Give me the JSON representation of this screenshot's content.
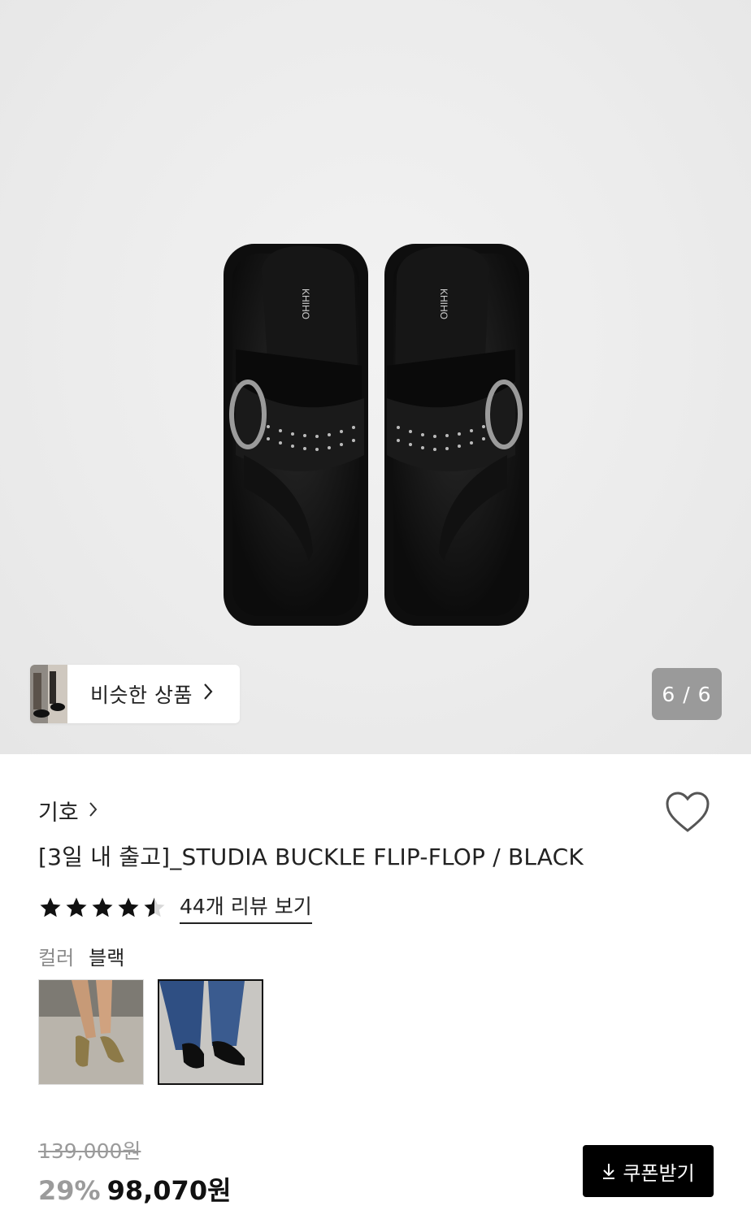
{
  "gallery": {
    "counter": "6 / 6",
    "similar_label": "비슷한 상품",
    "insole_logo": "KHIHO"
  },
  "product": {
    "brand": "기호",
    "title": "[3일 내 출고]_STUDIA BUCKLE FLIP-FLOP / BLACK",
    "rating_stars": 4.5,
    "review_link": "44개 리뷰 보기",
    "color_label": "컬러",
    "color_value": "블랙",
    "original_price": "139,000원",
    "discount": "29%",
    "price": "98,070원",
    "coupon_button": "쿠폰받기"
  },
  "colors": {
    "accent": "#000000",
    "muted": "#9a9a9a"
  }
}
